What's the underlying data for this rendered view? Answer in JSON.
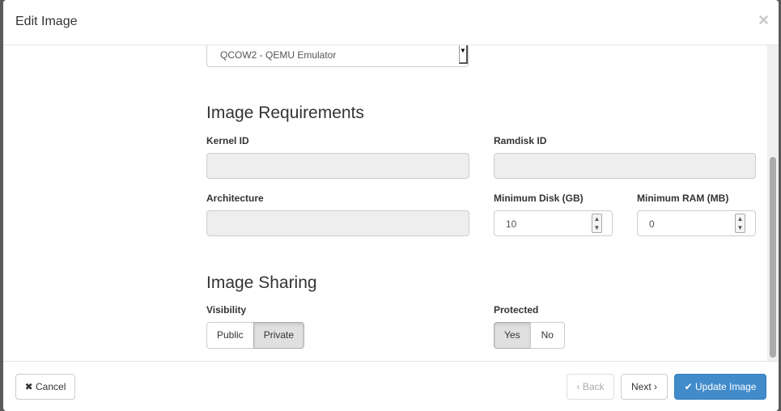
{
  "header": {
    "title": "Edit Image",
    "close_icon": "×"
  },
  "format": {
    "selected": "QCOW2 - QEMU Emulator"
  },
  "requirements": {
    "heading": "Image Requirements",
    "kernel_label": "Kernel ID",
    "ramdisk_label": "Ramdisk ID",
    "arch_label": "Architecture",
    "min_disk_label": "Minimum Disk (GB)",
    "min_disk_value": "10",
    "min_ram_label": "Minimum RAM (MB)",
    "min_ram_value": "0"
  },
  "sharing": {
    "heading": "Image Sharing",
    "visibility_label": "Visibility",
    "visibility_options": [
      "Public",
      "Private"
    ],
    "visibility_selected": "Private",
    "protected_label": "Protected",
    "protected_options": [
      "Yes",
      "No"
    ],
    "protected_selected": "Yes"
  },
  "footer": {
    "cancel": "✖ Cancel",
    "back": "‹ Back",
    "next": "Next ›",
    "update": "✔ Update Image"
  },
  "colors": {
    "primary": "#428bca"
  }
}
